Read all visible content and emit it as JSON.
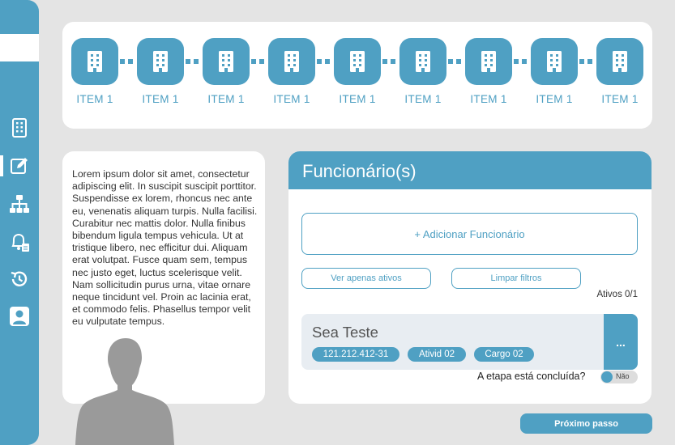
{
  "colors": {
    "accent": "#4fa0c3",
    "background": "#e4e4e4",
    "card": "#ffffff"
  },
  "sidebar": {
    "icons": [
      "building-icon",
      "edit-icon",
      "org-chart-icon",
      "bell-document-icon",
      "history-icon",
      "user-icon"
    ],
    "active": "edit-icon"
  },
  "stepper": {
    "steps": [
      {
        "label": "ITEM 1",
        "icon": "building-icon"
      },
      {
        "label": "ITEM 1",
        "icon": "building-icon"
      },
      {
        "label": "ITEM 1",
        "icon": "building-icon"
      },
      {
        "label": "ITEM 1",
        "icon": "building-icon"
      },
      {
        "label": "ITEM 1",
        "icon": "building-icon"
      },
      {
        "label": "ITEM 1",
        "icon": "building-icon"
      },
      {
        "label": "ITEM 1",
        "icon": "building-icon"
      },
      {
        "label": "ITEM 1",
        "icon": "building-icon"
      },
      {
        "label": "ITEM 1",
        "icon": "building-icon"
      }
    ]
  },
  "info": {
    "text": "Lorem ipsum dolor sit amet, consectetur adipiscing elit. In suscipit suscipit porttitor. Suspendisse ex lorem, rhoncus nec ante eu, venenatis aliquam turpis. Nulla facilisi. Curabitur nec mattis dolor. Nulla finibus bibendum ligula tempus vehicula. Ut at tristique libero, nec efficitur dui. Aliquam erat volutpat. Fusce quam sem, tempus nec justo eget, luctus scelerisque velit. Nam sollicitudin purus urna, vitae ornare neque tincidunt vel. Proin ac lacinia erat, et commodo felis. Phasellus tempor velit eu vulputate tempus."
  },
  "funcionarios": {
    "title": "Funcionário(s)",
    "add_label": "+ Adicionar Funcionário",
    "filter_active_label": "Ver apenas ativos",
    "clear_filters_label": "Limpar filtros",
    "active_count": "Ativos 0/1",
    "employee": {
      "name": "Sea Teste",
      "tags": [
        "121.212.412-31",
        "Ativid 02",
        "Cargo 02"
      ],
      "more_label": "..."
    },
    "step_question": "A etapa está concluída?",
    "toggle_label": "Não"
  },
  "next_button_label": "Próximo passo"
}
